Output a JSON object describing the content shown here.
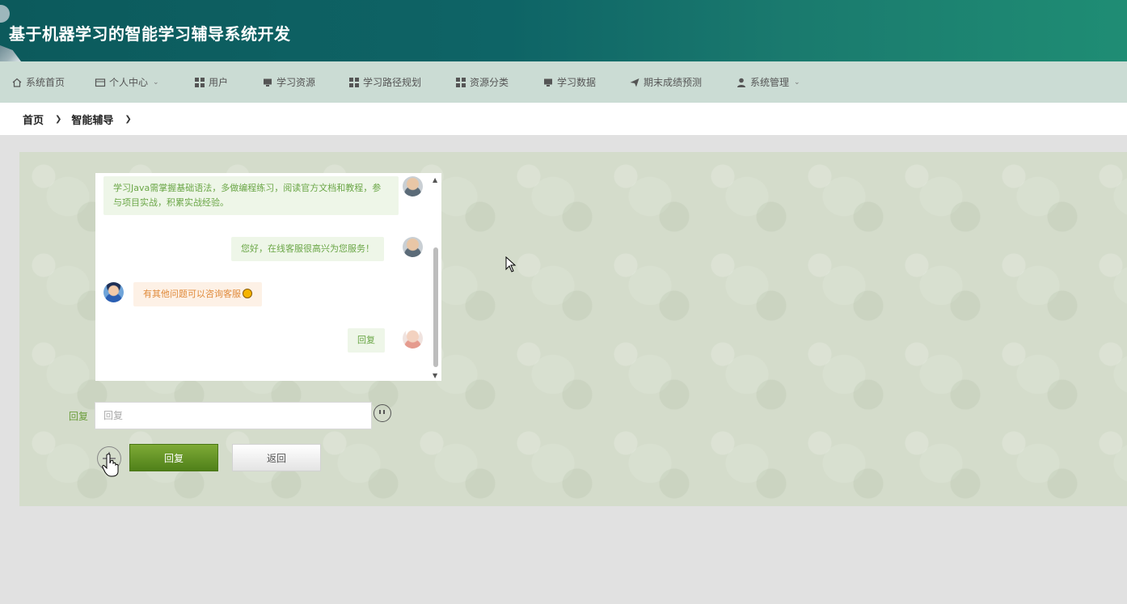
{
  "header": {
    "title": "基于机器学习的智能学习辅导系统开发"
  },
  "nav": {
    "items": [
      {
        "label": "系统首页",
        "icon": "home-icon"
      },
      {
        "label": "个人中心",
        "icon": "id-card-icon",
        "dropdown": true
      },
      {
        "label": "用户",
        "icon": "grid-icon"
      },
      {
        "label": "学习资源",
        "icon": "monitor-icon"
      },
      {
        "label": "学习路径规划",
        "icon": "grid-icon"
      },
      {
        "label": "资源分类",
        "icon": "grid-icon"
      },
      {
        "label": "学习数据",
        "icon": "monitor-icon"
      },
      {
        "label": "期末成绩预测",
        "icon": "paper-plane-icon"
      },
      {
        "label": "系统管理",
        "icon": "user-icon",
        "dropdown": true
      }
    ]
  },
  "breadcrumb": {
    "items": [
      "首页",
      "智能辅导"
    ]
  },
  "chat": {
    "messages": [
      {
        "side": "right",
        "text": "学习Java需掌握基础语法，多做编程练习，阅读官方文档和教程，参与项目实战，积累实战经验。"
      },
      {
        "side": "right",
        "text": "您好，在线客服很高兴为您服务！"
      },
      {
        "side": "left",
        "text": "有其他问题可以咨询客服"
      },
      {
        "side": "right",
        "text": "回复"
      }
    ]
  },
  "form": {
    "label": "回复",
    "input_placeholder": "回复",
    "submit_label": "回复",
    "back_label": "返回"
  },
  "colors": {
    "header_start": "#0c5a5c",
    "header_end": "#1f8d74",
    "nav_bg": "#cbdcd4",
    "accent_green": "#5e8f22",
    "bubble_right_text": "#6aa646",
    "bubble_left_text": "#e08a3a"
  }
}
